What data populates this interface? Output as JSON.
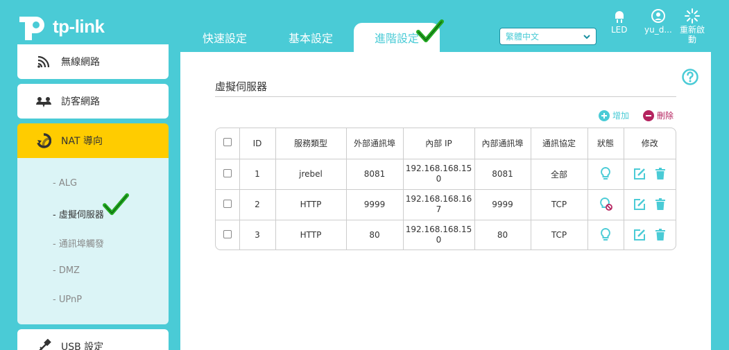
{
  "brand": {
    "name": "tp-link"
  },
  "tabs": [
    {
      "label": "快速設定"
    },
    {
      "label": "基本設定"
    },
    {
      "label": "進階設定"
    }
  ],
  "language": {
    "selected": "繁體中文"
  },
  "header_icons": {
    "led": "LED",
    "user": "yu_d...",
    "reboot_line1": "重新啟",
    "reboot_line2": "動"
  },
  "sidebar": {
    "items": [
      {
        "label": "無線網路",
        "icon": "wireless-icon"
      },
      {
        "label": "訪客網路",
        "icon": "guest-network-icon"
      },
      {
        "label": "NAT 導向",
        "icon": "nat-icon"
      },
      {
        "label": "USB 設定",
        "icon": "usb-icon"
      }
    ],
    "submenu": [
      {
        "label": "- ALG"
      },
      {
        "label": "- 虛擬伺服器"
      },
      {
        "label": "- 通訊埠觸發"
      },
      {
        "label": "- DMZ"
      },
      {
        "label": "- UPnP"
      }
    ]
  },
  "panel": {
    "title": "虛擬伺服器",
    "add_label": "增加",
    "delete_label": "刪除"
  },
  "table": {
    "headers": [
      "",
      "ID",
      "服務類型",
      "外部通訊埠",
      "內部 IP",
      "內部通訊埠",
      "通訊協定",
      "狀態",
      "修改"
    ],
    "rows": [
      {
        "id": "1",
        "service": "jrebel",
        "ext_port": "8081",
        "ip": "192.168.168.150",
        "int_port": "8081",
        "protocol": "全部",
        "status": "enabled"
      },
      {
        "id": "2",
        "service": "HTTP",
        "ext_port": "9999",
        "ip": "192.168.168.167",
        "int_port": "9999",
        "protocol": "TCP",
        "status": "disabled"
      },
      {
        "id": "3",
        "service": "HTTP",
        "ext_port": "80",
        "ip": "192.168.168.150",
        "int_port": "80",
        "protocol": "TCP",
        "status": "enabled"
      }
    ]
  },
  "colors": {
    "accent": "#4acbd6",
    "active_menu": "#ffcc00",
    "delete": "#b5235f",
    "check": "#22aa22"
  }
}
